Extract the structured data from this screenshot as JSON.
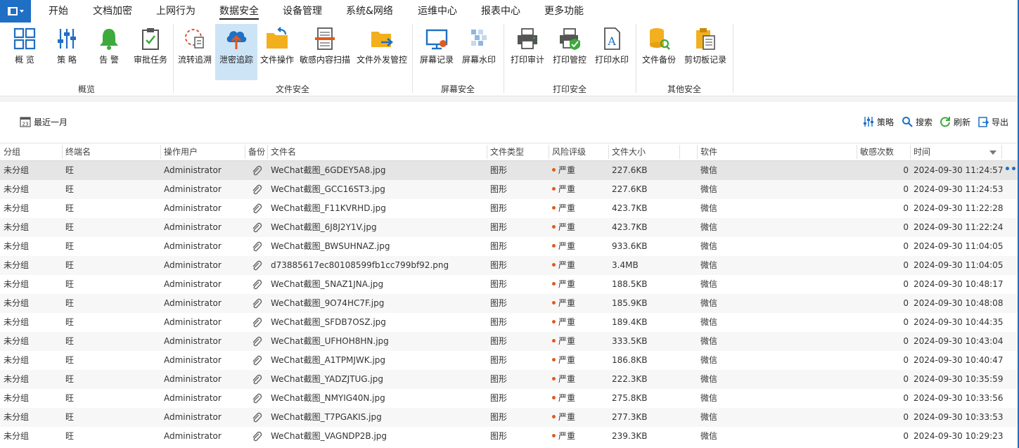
{
  "menu": {
    "items": [
      "开始",
      "文档加密",
      "上网行为",
      "数据安全",
      "设备管理",
      "系统&网络",
      "运维中心",
      "报表中心",
      "更多功能"
    ],
    "active_index": 3
  },
  "ribbon": {
    "groups": [
      {
        "label": "概览",
        "buttons": [
          {
            "label": "概 览",
            "icon": "overview-grid-icon"
          },
          {
            "label": "策 略",
            "icon": "policy-sliders-icon"
          },
          {
            "label": "告 警",
            "icon": "alarm-bell-icon"
          },
          {
            "label": "审批任务",
            "icon": "approval-clipboard-icon"
          }
        ]
      },
      {
        "label": "文件安全",
        "buttons": [
          {
            "label": "流转追溯",
            "icon": "flow-trace-icon"
          },
          {
            "label": "泄密追踪",
            "icon": "leak-tracking-cloud-icon",
            "selected": true
          },
          {
            "label": "文件操作",
            "icon": "file-operation-folder-icon"
          },
          {
            "label": "敏感内容扫描",
            "icon": "sensitive-scan-document-icon"
          },
          {
            "label": "文件外发管控",
            "icon": "file-outgoing-folder-icon"
          }
        ]
      },
      {
        "label": "屏幕安全",
        "buttons": [
          {
            "label": "屏幕记录",
            "icon": "screen-record-icon"
          },
          {
            "label": "屏幕水印",
            "icon": "screen-watermark-icon"
          }
        ]
      },
      {
        "label": "打印安全",
        "buttons": [
          {
            "label": "打印审计",
            "icon": "print-audit-icon"
          },
          {
            "label": "打印管控",
            "icon": "print-control-icon"
          },
          {
            "label": "打印水印",
            "icon": "print-watermark-icon"
          }
        ]
      },
      {
        "label": "其他安全",
        "buttons": [
          {
            "label": "文件备份",
            "icon": "file-backup-icon"
          },
          {
            "label": "剪切板记录",
            "icon": "clipboard-record-icon"
          }
        ]
      }
    ]
  },
  "toolbar": {
    "date_range": "最近一月",
    "calendar_day": "23",
    "policy_label": "策略",
    "search_label": "搜索",
    "refresh_label": "刷新",
    "export_label": "导出"
  },
  "table": {
    "columns": [
      "分组",
      "终端名",
      "操作用户",
      "备份",
      "文件名",
      "文件类型",
      "风险评级",
      "文件大小",
      "",
      "软件",
      "敏感次数",
      "时间"
    ],
    "rows": [
      [
        "未分组",
        "旺",
        "Administrator",
        "WeChat截图_6GDEY5A8.jpg",
        "图形",
        "严重",
        "227.6KB",
        "微信",
        "0",
        "2024-09-30 11:24:57"
      ],
      [
        "未分组",
        "旺",
        "Administrator",
        "WeChat截图_GCC16ST3.jpg",
        "图形",
        "严重",
        "227.6KB",
        "微信",
        "0",
        "2024-09-30 11:24:53"
      ],
      [
        "未分组",
        "旺",
        "Administrator",
        "WeChat截图_F11KVRHD.jpg",
        "图形",
        "严重",
        "423.7KB",
        "微信",
        "0",
        "2024-09-30 11:22:28"
      ],
      [
        "未分组",
        "旺",
        "Administrator",
        "WeChat截图_6J8J2Y1V.jpg",
        "图形",
        "严重",
        "423.7KB",
        "微信",
        "0",
        "2024-09-30 11:22:24"
      ],
      [
        "未分组",
        "旺",
        "Administrator",
        "WeChat截图_BWSUHNAZ.jpg",
        "图形",
        "严重",
        "933.6KB",
        "微信",
        "0",
        "2024-09-30 11:04:05"
      ],
      [
        "未分组",
        "旺",
        "Administrator",
        "d73885617ec80108599fb1cc799bf92.png",
        "图形",
        "严重",
        "3.4MB",
        "微信",
        "0",
        "2024-09-30 11:04:05"
      ],
      [
        "未分组",
        "旺",
        "Administrator",
        "WeChat截图_5NAZ1JNA.jpg",
        "图形",
        "严重",
        "188.5KB",
        "微信",
        "0",
        "2024-09-30 10:48:17"
      ],
      [
        "未分组",
        "旺",
        "Administrator",
        "WeChat截图_9O74HC7F.jpg",
        "图形",
        "严重",
        "185.9KB",
        "微信",
        "0",
        "2024-09-30 10:48:08"
      ],
      [
        "未分组",
        "旺",
        "Administrator",
        "WeChat截图_SFDB7OSZ.jpg",
        "图形",
        "严重",
        "189.4KB",
        "微信",
        "0",
        "2024-09-30 10:44:35"
      ],
      [
        "未分组",
        "旺",
        "Administrator",
        "WeChat截图_UFHOH8HN.jpg",
        "图形",
        "严重",
        "333.5KB",
        "微信",
        "0",
        "2024-09-30 10:43:04"
      ],
      [
        "未分组",
        "旺",
        "Administrator",
        "WeChat截图_A1TPMJWK.jpg",
        "图形",
        "严重",
        "186.8KB",
        "微信",
        "0",
        "2024-09-30 10:40:47"
      ],
      [
        "未分组",
        "旺",
        "Administrator",
        "WeChat截图_YADZJTUG.jpg",
        "图形",
        "严重",
        "222.3KB",
        "微信",
        "0",
        "2024-09-30 10:35:59"
      ],
      [
        "未分组",
        "旺",
        "Administrator",
        "WeChat截图_NMYIG40N.jpg",
        "图形",
        "严重",
        "275.8KB",
        "微信",
        "0",
        "2024-09-30 10:33:56"
      ],
      [
        "未分组",
        "旺",
        "Administrator",
        "WeChat截图_T7PGAKIS.jpg",
        "图形",
        "严重",
        "277.3KB",
        "微信",
        "0",
        "2024-09-30 10:33:53"
      ],
      [
        "未分组",
        "旺",
        "Administrator",
        "WeChat截图_VAGNDP2B.jpg",
        "图形",
        "严重",
        "239.3KB",
        "微信",
        "0",
        "2024-09-30 10:29:23"
      ]
    ],
    "selected_row": 0,
    "row_more": "•••"
  },
  "colors": {
    "accent": "#1f6fc4",
    "selected_ribbon": "#cde4f7",
    "risk_severe": "#e2591c",
    "selected_row": "#e5e5e5"
  }
}
